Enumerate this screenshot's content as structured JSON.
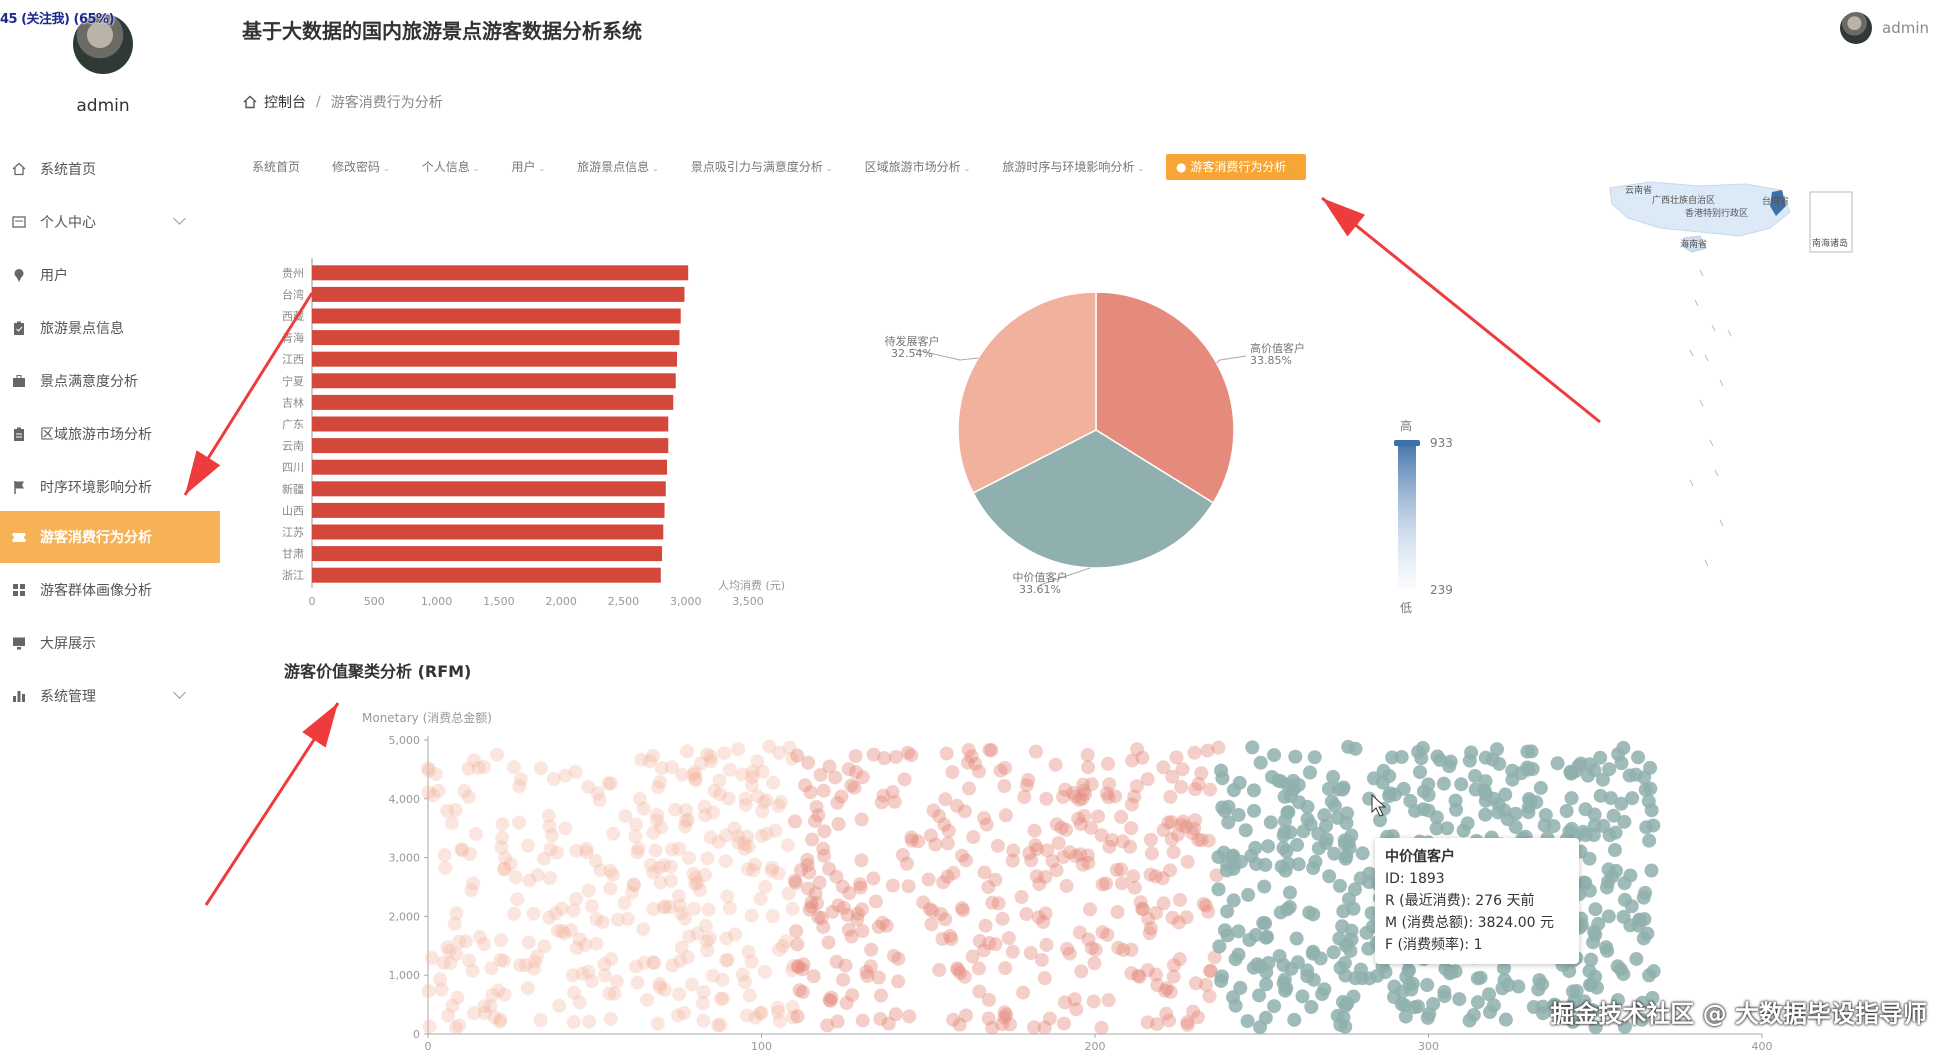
{
  "overlay_label": "45 (关注我) (65%)",
  "sidebar": {
    "username": "admin",
    "items": [
      {
        "label": "系统首页",
        "icon": "home-icon"
      },
      {
        "label": "个人中心",
        "icon": "profile-icon",
        "has_arrow": true
      },
      {
        "label": "用户",
        "icon": "pin-icon"
      },
      {
        "label": "旅游景点信息",
        "icon": "clipboard-icon"
      },
      {
        "label": "景点满意度分析",
        "icon": "briefcase-icon"
      },
      {
        "label": "区域旅游市场分析",
        "icon": "clipboard-list-icon"
      },
      {
        "label": "时序环境影响分析",
        "icon": "flag-icon"
      },
      {
        "label": "游客消费行为分析",
        "icon": "ticket-icon",
        "active": true
      },
      {
        "label": "游客群体画像分析",
        "icon": "grid-icon"
      },
      {
        "label": "大屏展示",
        "icon": "monitor-icon"
      },
      {
        "label": "系统管理",
        "icon": "bar-chart-icon",
        "has_arrow": true
      }
    ]
  },
  "header": {
    "title": "基于大数据的国内旅游景点游客数据分析系统",
    "username": "admin"
  },
  "breadcrumb": {
    "home": "控制台",
    "separator": "/",
    "current": "游客消费行为分析"
  },
  "tabs": [
    {
      "label": "系统首页",
      "caret": false
    },
    {
      "label": "修改密码",
      "caret": true
    },
    {
      "label": "个人信息",
      "caret": true
    },
    {
      "label": "用户",
      "caret": true
    },
    {
      "label": "旅游景点信息",
      "caret": true
    },
    {
      "label": "景点吸引力与满意度分析",
      "caret": true
    },
    {
      "label": "区域旅游市场分析",
      "caret": true
    },
    {
      "label": "旅游时序与环境影响分析",
      "caret": true
    },
    {
      "label": "● 游客消费行为分析",
      "caret": true,
      "active": true
    }
  ],
  "map": {
    "labels": [
      "云南省",
      "广西壮族自治区",
      "香港特别行政区",
      "海南省",
      "台湾省",
      "南海诸岛"
    ],
    "legend_high": "高",
    "legend_low": "低",
    "legend_max": "933",
    "legend_min": "239",
    "color_high": "#3d6fa8",
    "color_low": "#e8f1fb"
  },
  "chart_data": [
    {
      "type": "bar",
      "orientation": "horizontal",
      "categories": [
        "贵州",
        "台湾",
        "西藏",
        "青海",
        "江西",
        "宁夏",
        "吉林",
        "广东",
        "云南",
        "四川",
        "新疆",
        "山西",
        "江苏",
        "甘肃",
        "浙江"
      ],
      "values": [
        3020,
        2990,
        2960,
        2950,
        2930,
        2920,
        2900,
        2860,
        2860,
        2850,
        2840,
        2830,
        2820,
        2810,
        2800
      ],
      "xlabel": "人均消费 (元)",
      "xticks": [
        "0",
        "500",
        "1,000",
        "1,500",
        "2,000",
        "2,500",
        "3,000",
        "3,500"
      ],
      "xlim": [
        0,
        3500
      ],
      "color": "#d4483b"
    },
    {
      "type": "pie",
      "slices": [
        {
          "name": "高价值客户",
          "label": "高价值客户",
          "pct_label": "33.85%",
          "value": 33.85,
          "color": "#e58b7c"
        },
        {
          "name": "中价值客户",
          "label": "中价值客户",
          "pct_label": "33.61%",
          "value": 33.61,
          "color": "#8fb0ae"
        },
        {
          "name": "待发展客户",
          "label": "待发展客户",
          "pct_label": "32.54%",
          "value": 32.54,
          "color": "#f2b19c"
        }
      ]
    },
    {
      "type": "scatter",
      "title": "游客价值聚类分析 (RFM)",
      "ylabel": "Monetary (消费总金额)",
      "xlim": [
        0,
        400
      ],
      "ylim": [
        0,
        5000
      ],
      "xticks": [
        "0",
        "100",
        "200",
        "300",
        "400"
      ],
      "yticks": [
        "0",
        "1,000",
        "2,000",
        "3,000",
        "4,000",
        "5,000"
      ],
      "series": [
        {
          "name": "待发展客户",
          "x_range": [
            0,
            110
          ],
          "color": "#f2b19c"
        },
        {
          "name": "高价值客户",
          "x_range": [
            110,
            237
          ],
          "color": "#e58b7c"
        },
        {
          "name": "中价值客户",
          "x_range": [
            237,
            368
          ],
          "color": "#8fb0ae"
        }
      ],
      "tooltip": {
        "title": "中价值客户",
        "lines": [
          "ID: 1893",
          "R (最近消费): 276 天前",
          "M (消费总额): 3824.00 元",
          "F (消费频率): 1"
        ]
      }
    }
  ],
  "watermark": "掘金技术社区 @ 大数据毕设指导师"
}
